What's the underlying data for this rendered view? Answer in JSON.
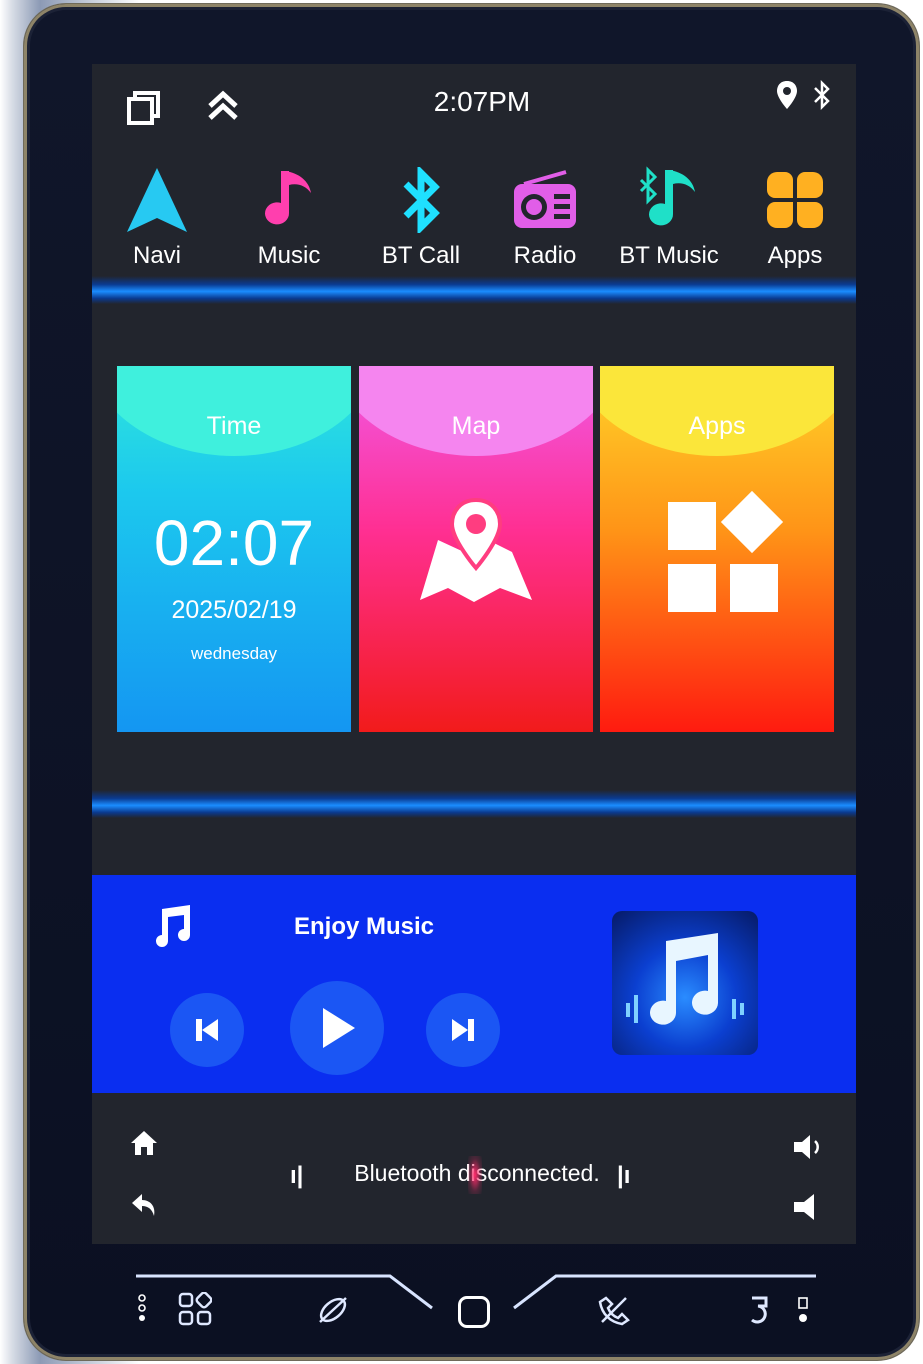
{
  "status": {
    "time": "2:07PM",
    "icons": [
      "recent-apps-icon",
      "double-chevron-up-icon",
      "location-pin-icon",
      "bluetooth-icon"
    ]
  },
  "apps": [
    {
      "label": "Navi",
      "icon": "navigation-arrow-icon",
      "color": "#27c9f2"
    },
    {
      "label": "Music",
      "icon": "music-note-icon",
      "color": "#ff3fae"
    },
    {
      "label": "BT Call",
      "icon": "bluetooth-icon",
      "color": "#1fe0ff"
    },
    {
      "label": "Radio",
      "icon": "radio-icon",
      "color": "#e15ee8"
    },
    {
      "label": "BT Music",
      "icon": "bt-music-icon",
      "color": "#1fe0c8"
    },
    {
      "label": "Apps",
      "icon": "clover-apps-icon",
      "color": "#ffb021"
    }
  ],
  "cards": {
    "time": {
      "title": "Time",
      "clock": "02:07",
      "date": "2025/02/19",
      "weekday": "wednesday"
    },
    "map": {
      "title": "Map",
      "icon": "map-pin-icon"
    },
    "apps": {
      "title": "Apps",
      "icon": "app-grid-icon"
    }
  },
  "music": {
    "title": "Enjoy Music",
    "icons": [
      "music-note-icon",
      "previous-icon",
      "play-icon",
      "next-icon",
      "album-art-icon"
    ]
  },
  "bottom": {
    "status": "Bluetooth disconnected.",
    "icons": [
      "home-icon",
      "back-icon",
      "volume-up-icon",
      "volume-down-icon"
    ]
  },
  "navbar": {
    "icons": [
      "mic-icon",
      "apps-grid-icon",
      "satellite-icon",
      "home-button-icon",
      "no-call-icon",
      "return-icon",
      "rst-icon"
    ]
  },
  "colors": {
    "screen": "#22252d",
    "music_panel": "#0a2ef0",
    "glow": "#1b8dff"
  }
}
